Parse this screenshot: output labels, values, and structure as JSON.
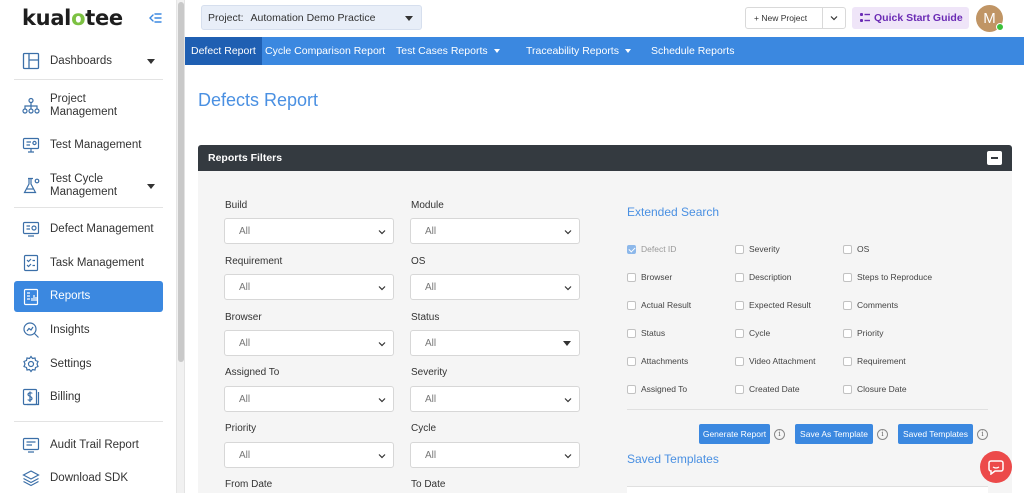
{
  "app": {
    "logo_prefix": "kual",
    "logo_o": "o",
    "logo_suffix": "tee"
  },
  "sidebar": {
    "items": [
      {
        "label": "Dashboards",
        "icon": "dashboard-icon",
        "caret": true
      },
      {
        "label": "Project Management",
        "icon": "sitemap-icon"
      },
      {
        "label": "Test Management",
        "icon": "test-monitor-icon"
      },
      {
        "label": "Test Cycle Management",
        "icon": "flask-icon",
        "caret": true
      },
      {
        "label": "Defect Management",
        "icon": "bug-screen-icon"
      },
      {
        "label": "Task Management",
        "icon": "checklist-icon"
      },
      {
        "label": "Reports",
        "icon": "report-icon",
        "active": true
      },
      {
        "label": "Insights",
        "icon": "insights-icon"
      },
      {
        "label": "Settings",
        "icon": "gear-icon"
      },
      {
        "label": "Billing",
        "icon": "billing-icon"
      },
      {
        "label": "Audit Trail Report",
        "icon": "audit-icon"
      },
      {
        "label": "Download SDK",
        "icon": "layers-icon"
      }
    ]
  },
  "topbar": {
    "project_label": "Project:",
    "project_value": "Automation Demo Practice",
    "new_project": "+ New Project",
    "quick_start": "Quick Start Guide",
    "avatar_initial": "M"
  },
  "tabs": [
    {
      "label": "Defect Report",
      "active": true
    },
    {
      "label": "Cycle Comparison Report"
    },
    {
      "label": "Test Cases Reports",
      "caret": true
    },
    {
      "label": "Traceability Reports",
      "caret": true
    },
    {
      "label": "Schedule Reports"
    }
  ],
  "page": {
    "title": "Defects Report"
  },
  "filters": {
    "header": "Reports Filters",
    "fields": [
      {
        "label": "Build",
        "value": "All"
      },
      {
        "label": "Module",
        "value": "All"
      },
      {
        "label": "Requirement",
        "value": "All"
      },
      {
        "label": "OS",
        "value": "All"
      },
      {
        "label": "Browser",
        "value": "All"
      },
      {
        "label": "Status",
        "value": "All"
      },
      {
        "label": "Assigned To",
        "value": "All"
      },
      {
        "label": "Severity",
        "value": "All"
      },
      {
        "label": "Priority",
        "value": "All"
      },
      {
        "label": "Cycle",
        "value": "All"
      },
      {
        "label": "From Date"
      },
      {
        "label": "To Date"
      }
    ]
  },
  "extended_search": {
    "title": "Extended Search",
    "options": [
      {
        "label": "Defect ID",
        "checked": true
      },
      {
        "label": "Severity"
      },
      {
        "label": "OS"
      },
      {
        "label": "Browser"
      },
      {
        "label": "Description"
      },
      {
        "label": "Steps to Reproduce"
      },
      {
        "label": "Actual Result"
      },
      {
        "label": "Expected Result"
      },
      {
        "label": "Comments"
      },
      {
        "label": "Status"
      },
      {
        "label": "Cycle"
      },
      {
        "label": "Priority"
      },
      {
        "label": "Attachments"
      },
      {
        "label": "Video Attachment"
      },
      {
        "label": "Requirement"
      },
      {
        "label": "Assigned To"
      },
      {
        "label": "Created Date"
      },
      {
        "label": "Closure Date"
      }
    ]
  },
  "actions": {
    "generate": "Generate Report",
    "save_template": "Save As Template",
    "saved_templates": "Saved Templates",
    "info": "i"
  },
  "saved_templates": {
    "title": "Saved Templates"
  },
  "colors": {
    "accent": "#3b88e0",
    "dark_header": "#343a40",
    "title_blue": "#4a90e2"
  }
}
